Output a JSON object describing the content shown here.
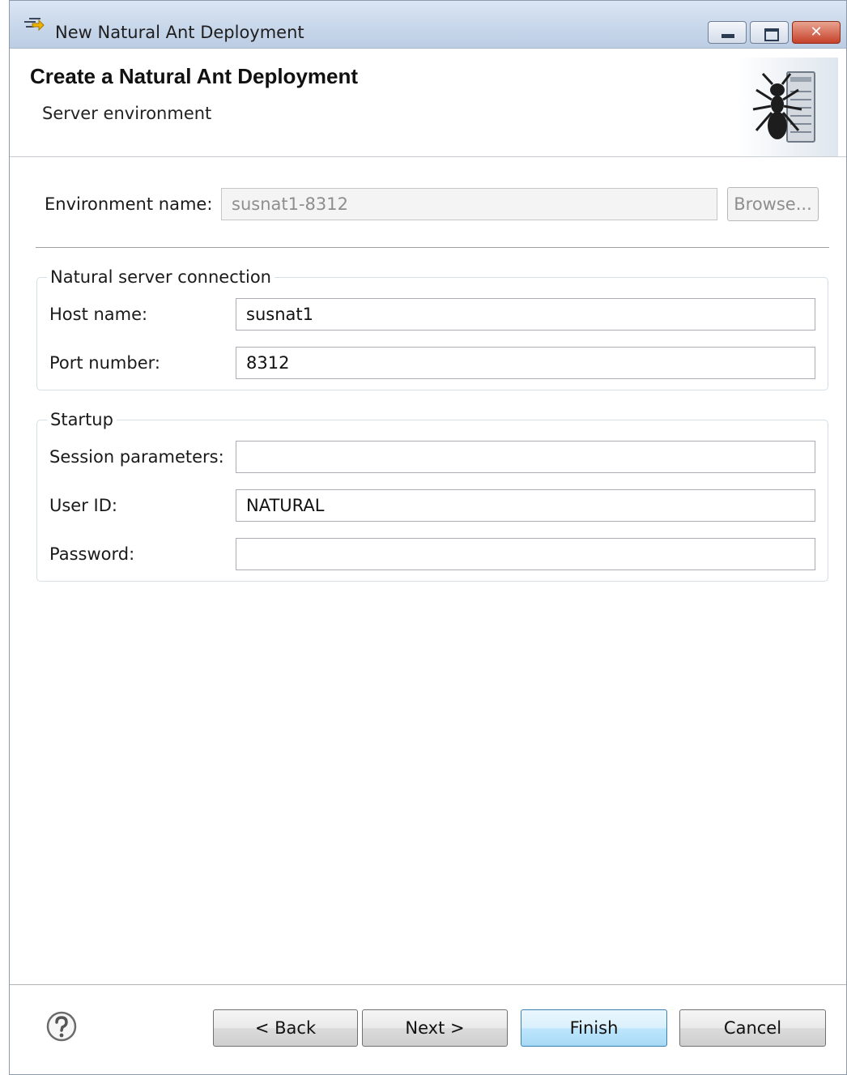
{
  "window": {
    "title": "New Natural Ant Deployment",
    "controls": {
      "minimize": "minimize-icon",
      "maximize": "maximize-icon",
      "close": "✕"
    }
  },
  "banner": {
    "title": "Create a Natural Ant Deployment",
    "subtitle": "Server environment",
    "image": "ant-server-icon"
  },
  "environment": {
    "label": "Environment name:",
    "value": "susnat1-8312",
    "browse_label": "Browse..."
  },
  "connection_group": {
    "title": "Natural server connection",
    "host_label": "Host name:",
    "host_value": "susnat1",
    "port_label": "Port number:",
    "port_value": "8312"
  },
  "startup_group": {
    "title": "Startup",
    "session_label": "Session parameters:",
    "session_value": "",
    "userid_label": "User ID:",
    "userid_value": "NATURAL",
    "password_label": "Password:",
    "password_value": ""
  },
  "footer": {
    "help_icon": "help-icon",
    "back_label": "< Back",
    "next_label": "Next >",
    "finish_label": "Finish",
    "cancel_label": "Cancel"
  },
  "colors": {
    "titlebar": "#c8d7ea",
    "close_button": "#c6412b",
    "default_button_border": "#3c7fb1"
  }
}
